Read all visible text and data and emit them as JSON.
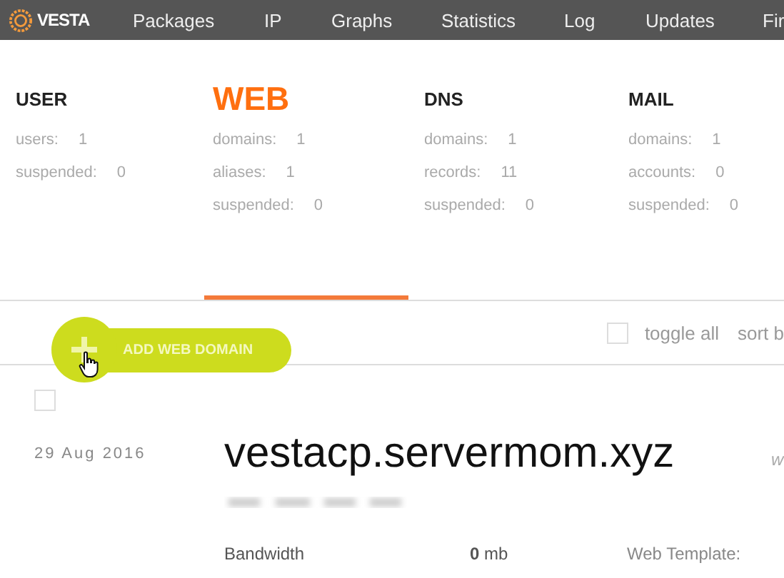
{
  "nav": {
    "logo": "VESTA",
    "items": [
      {
        "label": "Packages"
      },
      {
        "label": "IP"
      },
      {
        "label": "Graphs"
      },
      {
        "label": "Statistics"
      },
      {
        "label": "Log"
      },
      {
        "label": "Updates"
      },
      {
        "label": "Fir"
      }
    ]
  },
  "stats": [
    {
      "title": "USER",
      "selected": false,
      "rows": [
        {
          "label": "users:",
          "value": "1"
        },
        {
          "label": "suspended:",
          "value": "0"
        }
      ]
    },
    {
      "title": "WEB",
      "selected": true,
      "rows": [
        {
          "label": "domains:",
          "value": "1"
        },
        {
          "label": "aliases:",
          "value": "1"
        },
        {
          "label": "suspended:",
          "value": "0"
        }
      ]
    },
    {
      "title": "DNS",
      "selected": false,
      "rows": [
        {
          "label": "domains:",
          "value": "1"
        },
        {
          "label": "records:",
          "value": "11"
        },
        {
          "label": "suspended:",
          "value": "0"
        }
      ]
    },
    {
      "title": "MAIL",
      "selected": false,
      "rows": [
        {
          "label": "domains:",
          "value": "1"
        },
        {
          "label": "accounts:",
          "value": "0"
        },
        {
          "label": "suspended:",
          "value": "0"
        }
      ]
    }
  ],
  "toolbar": {
    "add_button": "ADD WEB DOMAIN",
    "toggle_all": {
      "label": "toggle all",
      "checked": false
    },
    "sort": "sort b"
  },
  "domain": {
    "checked": false,
    "date": "29 Aug 2016",
    "name": "vestacp.servermom.xyz",
    "side": "w",
    "bandwidth_label": "Bandwidth",
    "bandwidth_value": "0",
    "bandwidth_unit": "mb",
    "template_label": "Web Template:"
  }
}
